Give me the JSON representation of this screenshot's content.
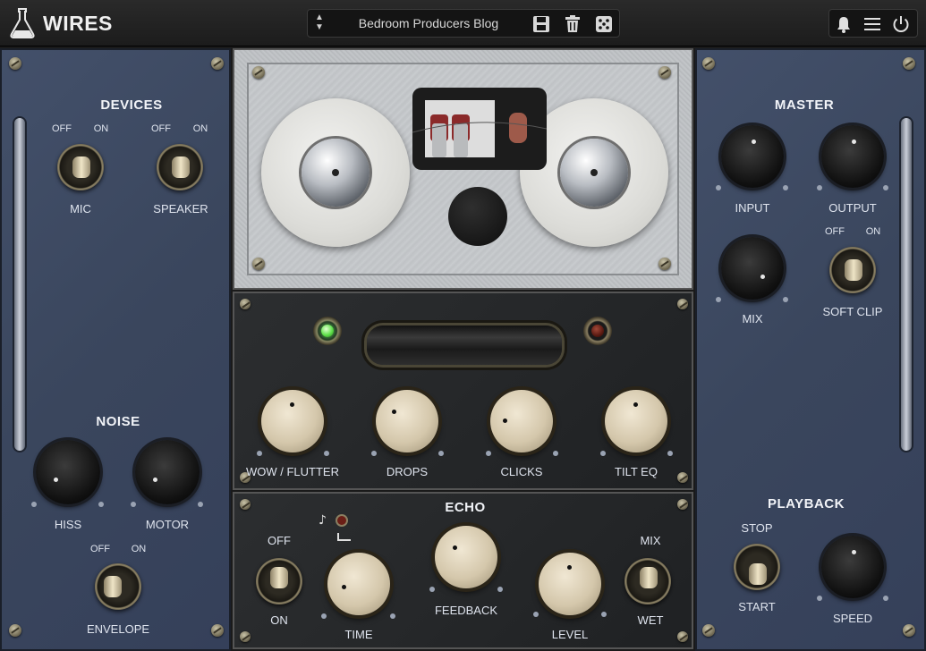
{
  "app": {
    "title": "WIRES"
  },
  "preset": {
    "name": "Bedroom Producers Blog"
  },
  "icons": {
    "logo": "flask-icon",
    "preset_arrows": "up-down-arrows-icon",
    "save": "floppy-disk-icon",
    "delete": "trash-icon",
    "random": "dice-icon",
    "notifications": "bell-icon",
    "menu": "hamburger-menu-icon",
    "power": "power-icon"
  },
  "devices": {
    "heading": "DEVICES",
    "mic": {
      "label": "MIC",
      "off": "OFF",
      "on": "ON",
      "state": "ON"
    },
    "speaker": {
      "label": "SPEAKER",
      "off": "OFF",
      "on": "ON",
      "state": "ON"
    }
  },
  "noise": {
    "heading": "NOISE",
    "hiss": {
      "label": "HISS"
    },
    "motor": {
      "label": "MOTOR"
    },
    "envelope": {
      "label": "ENVELOPE",
      "off": "OFF",
      "on": "ON"
    }
  },
  "fx": {
    "wow_flutter": {
      "label": "WOW / FLUTTER"
    },
    "drops": {
      "label": "DROPS"
    },
    "clicks": {
      "label": "CLICKS"
    },
    "tilt_eq": {
      "label": "TILT EQ"
    }
  },
  "echo": {
    "heading": "ECHO",
    "switch": {
      "off": "OFF",
      "on": "ON"
    },
    "time": {
      "label": "TIME"
    },
    "feedback": {
      "label": "FEEDBACK"
    },
    "level": {
      "label": "LEVEL"
    },
    "mix_switch": {
      "top": "MIX",
      "bottom": "WET"
    }
  },
  "master": {
    "heading": "MASTER",
    "input": {
      "label": "INPUT"
    },
    "output": {
      "label": "OUTPUT"
    },
    "mix": {
      "label": "MIX"
    },
    "soft_clip": {
      "label": "SOFT CLIP",
      "off": "OFF",
      "on": "ON"
    }
  },
  "playback": {
    "heading": "PLAYBACK",
    "stop": "STOP",
    "start": "START",
    "speed": {
      "label": "SPEED"
    }
  }
}
